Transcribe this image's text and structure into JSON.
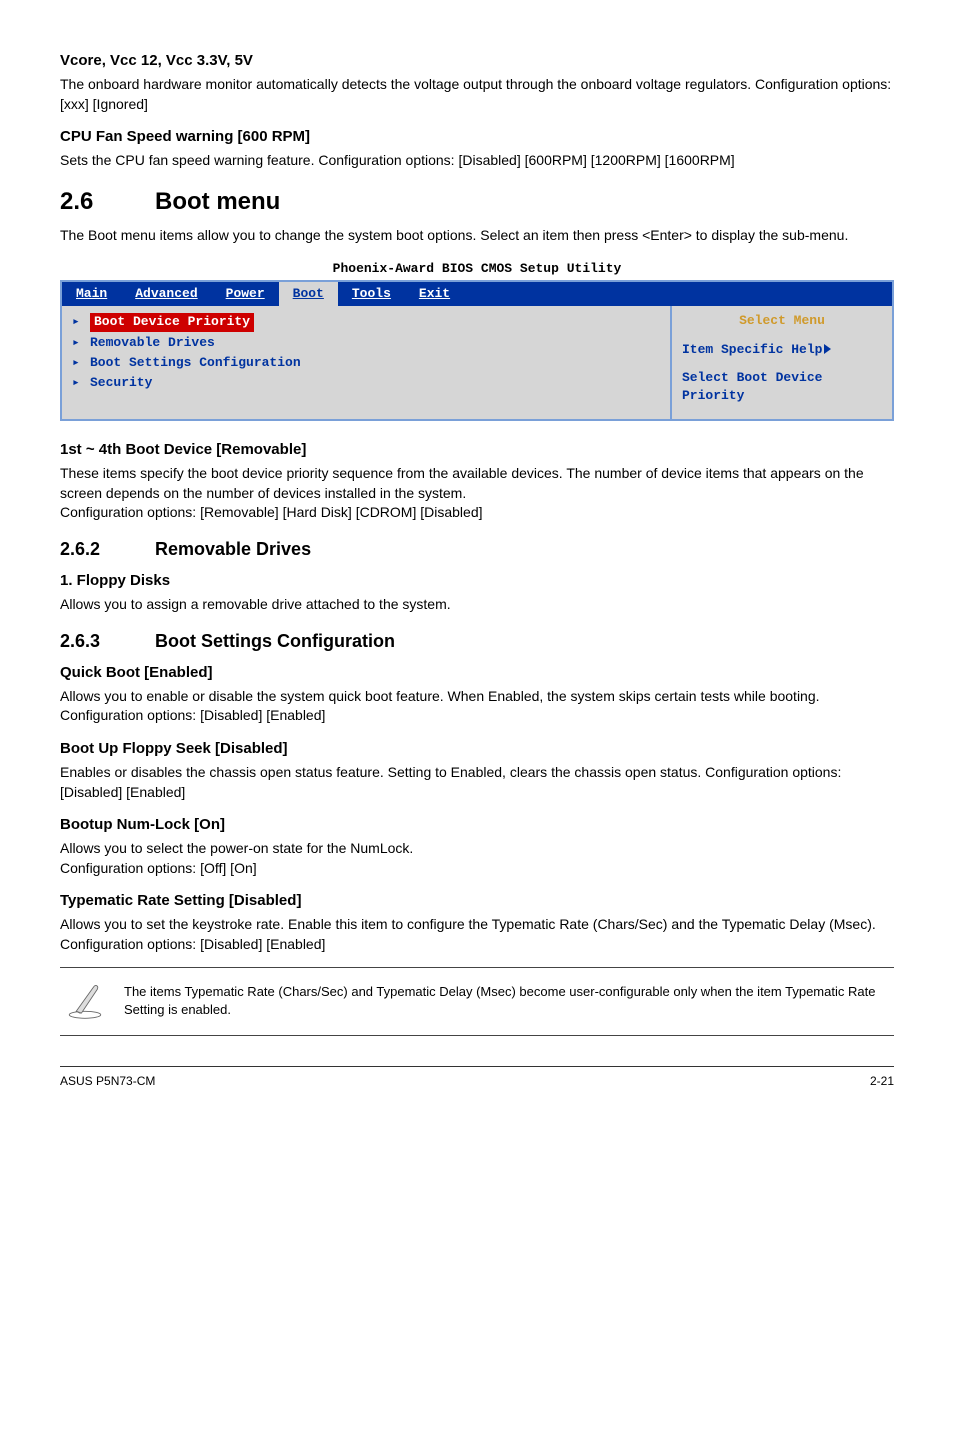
{
  "s1": {
    "h": "Vcore, Vcc 12, Vcc 3.3V, 5V",
    "p": "The onboard hardware monitor automatically detects the voltage output through the onboard voltage regulators. Configuration options: [xxx] [Ignored]"
  },
  "s2": {
    "h": "CPU Fan Speed warning [600 RPM]",
    "p": "Sets the CPU fan speed warning feature. Configuration options: [Disabled] [600RPM] [1200RPM] [1600RPM]"
  },
  "boot_menu": {
    "num": "2.6",
    "title": "Boot menu",
    "intro": "The Boot menu items allow you to change the system boot options. Select an item then press <Enter> to display the sub-menu."
  },
  "bios": {
    "title": "Phoenix-Award BIOS CMOS Setup Utility",
    "tabs": [
      "Main",
      "Advanced",
      "Power",
      "Boot",
      "Tools",
      "Exit"
    ],
    "active_tab_index": 3,
    "left_items": [
      "Boot Device Priority",
      "Removable Drives",
      "Boot Settings Configuration",
      "Security"
    ],
    "right": {
      "select": "Select Menu",
      "help": "Item Specific Help",
      "desc": "Select Boot Device Priority"
    }
  },
  "s_first": {
    "h": "1st ~ 4th Boot Device [Removable]",
    "p1": "These items specify the boot device priority sequence from the available devices. The number of device items that appears on the screen depends on the number of devices installed in the system.",
    "p2": "Configuration options: [Removable] [Hard Disk] [CDROM] [Disabled]"
  },
  "s262": {
    "num": "2.6.2",
    "title": "Removable Drives",
    "sub_h": "1. Floppy Disks",
    "sub_p": "Allows you to assign a removable drive attached to the system."
  },
  "s263": {
    "num": "2.6.3",
    "title": "Boot Settings Configuration"
  },
  "quick": {
    "h": "Quick Boot [Enabled]",
    "p": "Allows you to enable or disable the system quick boot feature. When Enabled, the system skips certain tests while booting. Configuration options: [Disabled] [Enabled]"
  },
  "floppy": {
    "h": "Boot Up Floppy Seek [Disabled]",
    "p": "Enables or disables the chassis open status feature. Setting to Enabled, clears the chassis open status. Configuration options: [Disabled] [Enabled]"
  },
  "numlock": {
    "h": "Bootup Num-Lock [On]",
    "p1": "Allows you to select the power-on state for the NumLock.",
    "p2": "Configuration options: [Off] [On]"
  },
  "typematic": {
    "h": "Typematic Rate Setting [Disabled]",
    "p1": "Allows you to set the keystroke rate. Enable this item to configure the Typematic Rate (Chars/Sec) and the Typematic Delay (Msec).",
    "p2": "Configuration options: [Disabled] [Enabled]"
  },
  "note": "The items Typematic Rate (Chars/Sec) and Typematic Delay (Msec) become user-configurable only when the item Typematic Rate Setting is enabled.",
  "footer": {
    "left": "ASUS P5N73-CM",
    "right": "2-21"
  }
}
